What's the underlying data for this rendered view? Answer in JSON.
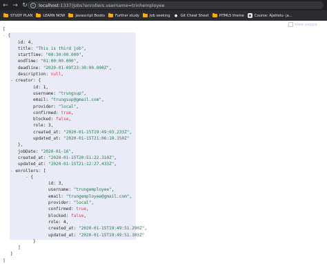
{
  "browser": {
    "url_host": "localhost",
    "url_rest": ":1337/jobs?enrollers.username=trinhemployee",
    "bookmarks": [
      {
        "label": "STUDY PLAN",
        "type": "folder"
      },
      {
        "label": "LEARN NOW",
        "type": "folder"
      },
      {
        "label": "Javascript Books",
        "type": "folder"
      },
      {
        "label": "Further study",
        "type": "folder"
      },
      {
        "label": "Job seeking",
        "type": "folder"
      },
      {
        "label": "Git Cheat Sheet",
        "type": "site"
      },
      {
        "label": "HTML5 theme",
        "type": "folder"
      },
      {
        "label": "Course: Ajattelu- ja...",
        "type": "site"
      }
    ]
  },
  "viewer": {
    "view_source_label": "View source"
  },
  "json_lines": [
    {
      "i": 0,
      "parts": [
        [
          "p",
          "["
        ]
      ]
    },
    {
      "i": 0,
      "parts": [
        [
          "t",
          "-"
        ],
        [
          "p",
          " {"
        ]
      ]
    },
    {
      "i": 1,
      "parts": [
        [
          "k",
          "id: "
        ],
        [
          "n",
          "4"
        ],
        [
          "p",
          ","
        ]
      ]
    },
    {
      "i": 1,
      "parts": [
        [
          "k",
          "title: "
        ],
        [
          "s",
          "\"This is third job\""
        ],
        [
          "p",
          ","
        ]
      ]
    },
    {
      "i": 1,
      "parts": [
        [
          "k",
          "startTime: "
        ],
        [
          "s",
          "\"00:30:00.000\""
        ],
        [
          "p",
          ","
        ]
      ]
    },
    {
      "i": 1,
      "parts": [
        [
          "k",
          "endTime: "
        ],
        [
          "s",
          "\"01:00:00.000\""
        ],
        [
          "p",
          ","
        ]
      ]
    },
    {
      "i": 1,
      "parts": [
        [
          "k",
          "deadline: "
        ],
        [
          "s",
          "\"2020-01-09T23:30:00.000Z\""
        ],
        [
          "p",
          ","
        ]
      ]
    },
    {
      "i": 1,
      "parts": [
        [
          "k",
          "description: "
        ],
        [
          "nul",
          "null"
        ],
        [
          "p",
          ","
        ]
      ]
    },
    {
      "i": 0.5,
      "parts": [
        [
          "t",
          "- "
        ],
        [
          "k",
          "creator: "
        ],
        [
          "p",
          "{"
        ]
      ]
    },
    {
      "i": 2,
      "parts": [
        [
          "k",
          "id: "
        ],
        [
          "n",
          "1"
        ],
        [
          "p",
          ","
        ]
      ]
    },
    {
      "i": 2,
      "parts": [
        [
          "k",
          "username: "
        ],
        [
          "s",
          "\"trungsup\""
        ],
        [
          "p",
          ","
        ]
      ]
    },
    {
      "i": 2,
      "parts": [
        [
          "k",
          "email: "
        ],
        [
          "s",
          "\"trungsup@gmail.com\""
        ],
        [
          "p",
          ","
        ]
      ]
    },
    {
      "i": 2,
      "parts": [
        [
          "k",
          "provider: "
        ],
        [
          "s",
          "\"local\""
        ],
        [
          "p",
          ","
        ]
      ]
    },
    {
      "i": 2,
      "parts": [
        [
          "k",
          "confirmed: "
        ],
        [
          "b",
          "true"
        ],
        [
          "p",
          ","
        ]
      ]
    },
    {
      "i": 2,
      "parts": [
        [
          "k",
          "blocked: "
        ],
        [
          "b",
          "false"
        ],
        [
          "p",
          ","
        ]
      ]
    },
    {
      "i": 2,
      "parts": [
        [
          "k",
          "role: "
        ],
        [
          "n",
          "3"
        ],
        [
          "p",
          ","
        ]
      ]
    },
    {
      "i": 2,
      "parts": [
        [
          "k",
          "created_at: "
        ],
        [
          "s",
          "\"2020-01-15T19:49:03.233Z\""
        ],
        [
          "p",
          ","
        ]
      ]
    },
    {
      "i": 2,
      "parts": [
        [
          "k",
          "updated_at: "
        ],
        [
          "s",
          "\"2020-01-15T21:06:19.150Z\""
        ]
      ]
    },
    {
      "i": 1,
      "parts": [
        [
          "p",
          "},"
        ]
      ]
    },
    {
      "i": 1,
      "parts": [
        [
          "k",
          "jobDate: "
        ],
        [
          "s",
          "\"2020-01-16\""
        ],
        [
          "p",
          ","
        ]
      ]
    },
    {
      "i": 1,
      "parts": [
        [
          "k",
          "created_at: "
        ],
        [
          "s",
          "\"2020-01-15T20:51:22.310Z\""
        ],
        [
          "p",
          ","
        ]
      ]
    },
    {
      "i": 1,
      "parts": [
        [
          "k",
          "updated_at: "
        ],
        [
          "s",
          "\"2020-01-15T21:12:27.433Z\""
        ],
        [
          "p",
          ","
        ]
      ]
    },
    {
      "i": 0.5,
      "parts": [
        [
          "t",
          "- "
        ],
        [
          "k",
          "enrollers: "
        ],
        [
          "p",
          "["
        ]
      ]
    },
    {
      "i": 1.5,
      "parts": [
        [
          "t",
          "- "
        ],
        [
          "p",
          "{"
        ]
      ]
    },
    {
      "i": 3,
      "parts": [
        [
          "k",
          "id: "
        ],
        [
          "n",
          "3"
        ],
        [
          "p",
          ","
        ]
      ]
    },
    {
      "i": 3,
      "parts": [
        [
          "k",
          "username: "
        ],
        [
          "s",
          "\"trungemployee\""
        ],
        [
          "p",
          ","
        ]
      ]
    },
    {
      "i": 3,
      "parts": [
        [
          "k",
          "email: "
        ],
        [
          "s",
          "\"trungemployee@gmail.com\""
        ],
        [
          "p",
          ","
        ]
      ]
    },
    {
      "i": 3,
      "parts": [
        [
          "k",
          "provider: "
        ],
        [
          "s",
          "\"local\""
        ],
        [
          "p",
          ","
        ]
      ]
    },
    {
      "i": 3,
      "parts": [
        [
          "k",
          "confirmed: "
        ],
        [
          "b",
          "true"
        ],
        [
          "p",
          ","
        ]
      ]
    },
    {
      "i": 3,
      "parts": [
        [
          "k",
          "blocked: "
        ],
        [
          "b",
          "false"
        ],
        [
          "p",
          ","
        ]
      ]
    },
    {
      "i": 3,
      "parts": [
        [
          "k",
          "role: "
        ],
        [
          "n",
          "4"
        ],
        [
          "p",
          ","
        ]
      ]
    },
    {
      "i": 3,
      "parts": [
        [
          "k",
          "created_at: "
        ],
        [
          "s",
          "\"2020-01-15T19:49:51.290Z\""
        ],
        [
          "p",
          ","
        ]
      ]
    },
    {
      "i": 3,
      "parts": [
        [
          "k",
          "updated_at: "
        ],
        [
          "s",
          "\"2020-01-15T19:49:51.303Z\""
        ]
      ]
    },
    {
      "i": 2,
      "parts": [
        [
          "p",
          "}"
        ]
      ]
    },
    {
      "i": 1,
      "parts": [
        [
          "p",
          "]"
        ]
      ]
    },
    {
      "i": 0.5,
      "parts": [
        [
          "p",
          "}"
        ]
      ]
    },
    {
      "i": 0,
      "parts": [
        [
          "p",
          "]"
        ]
      ]
    }
  ]
}
